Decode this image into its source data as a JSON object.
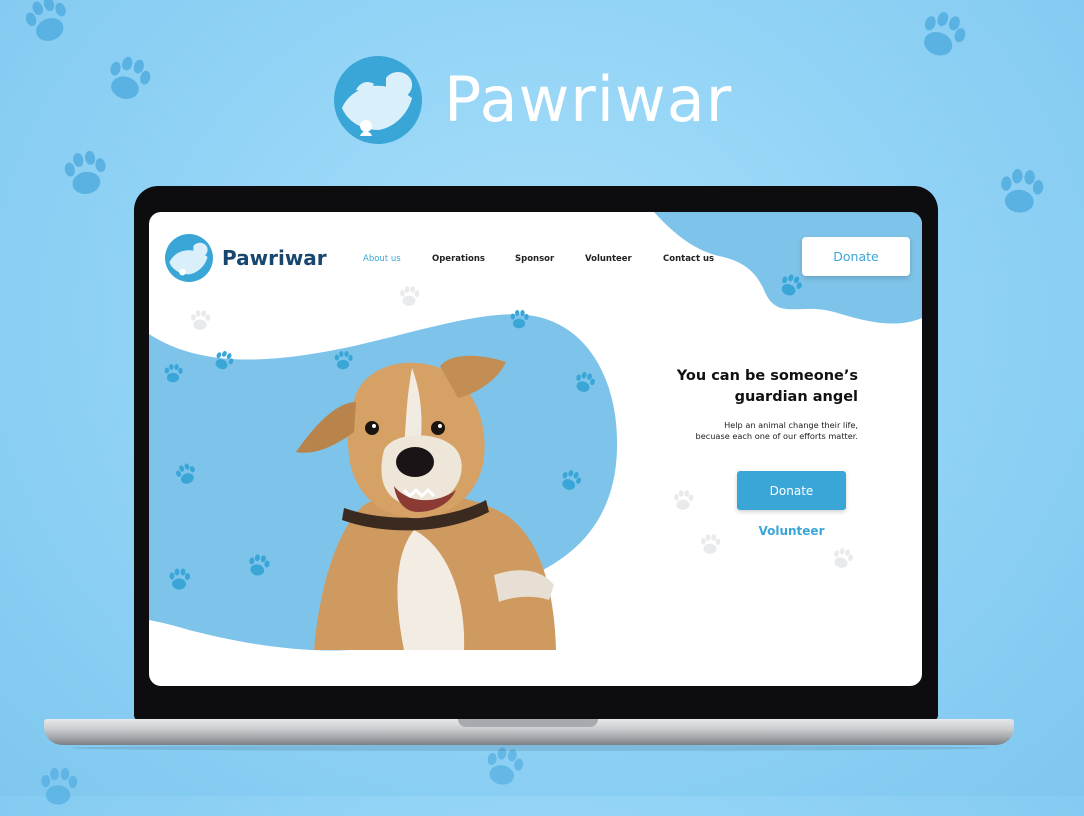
{
  "brand": {
    "title": "Pawriwar"
  },
  "site": {
    "name": "Pawriwar",
    "nav": [
      "About us",
      "Operations",
      "Sponsor",
      "Volunteer",
      "Contact us"
    ],
    "active_nav": "About us",
    "donate_top": "Donate"
  },
  "hero": {
    "headline_line1": "You can be someone’s",
    "headline_line2": "guardian angel",
    "subtext": "Help an animal change their life, becuase each one of our efforts matter.",
    "donate_label": "Donate",
    "volunteer_label": "Volunteer",
    "image": "dog-photo"
  },
  "colors": {
    "accent": "#3aa6d8",
    "blob": "#7ec4ea",
    "background": "#8fd2f5",
    "brand_text": "#17466e"
  }
}
